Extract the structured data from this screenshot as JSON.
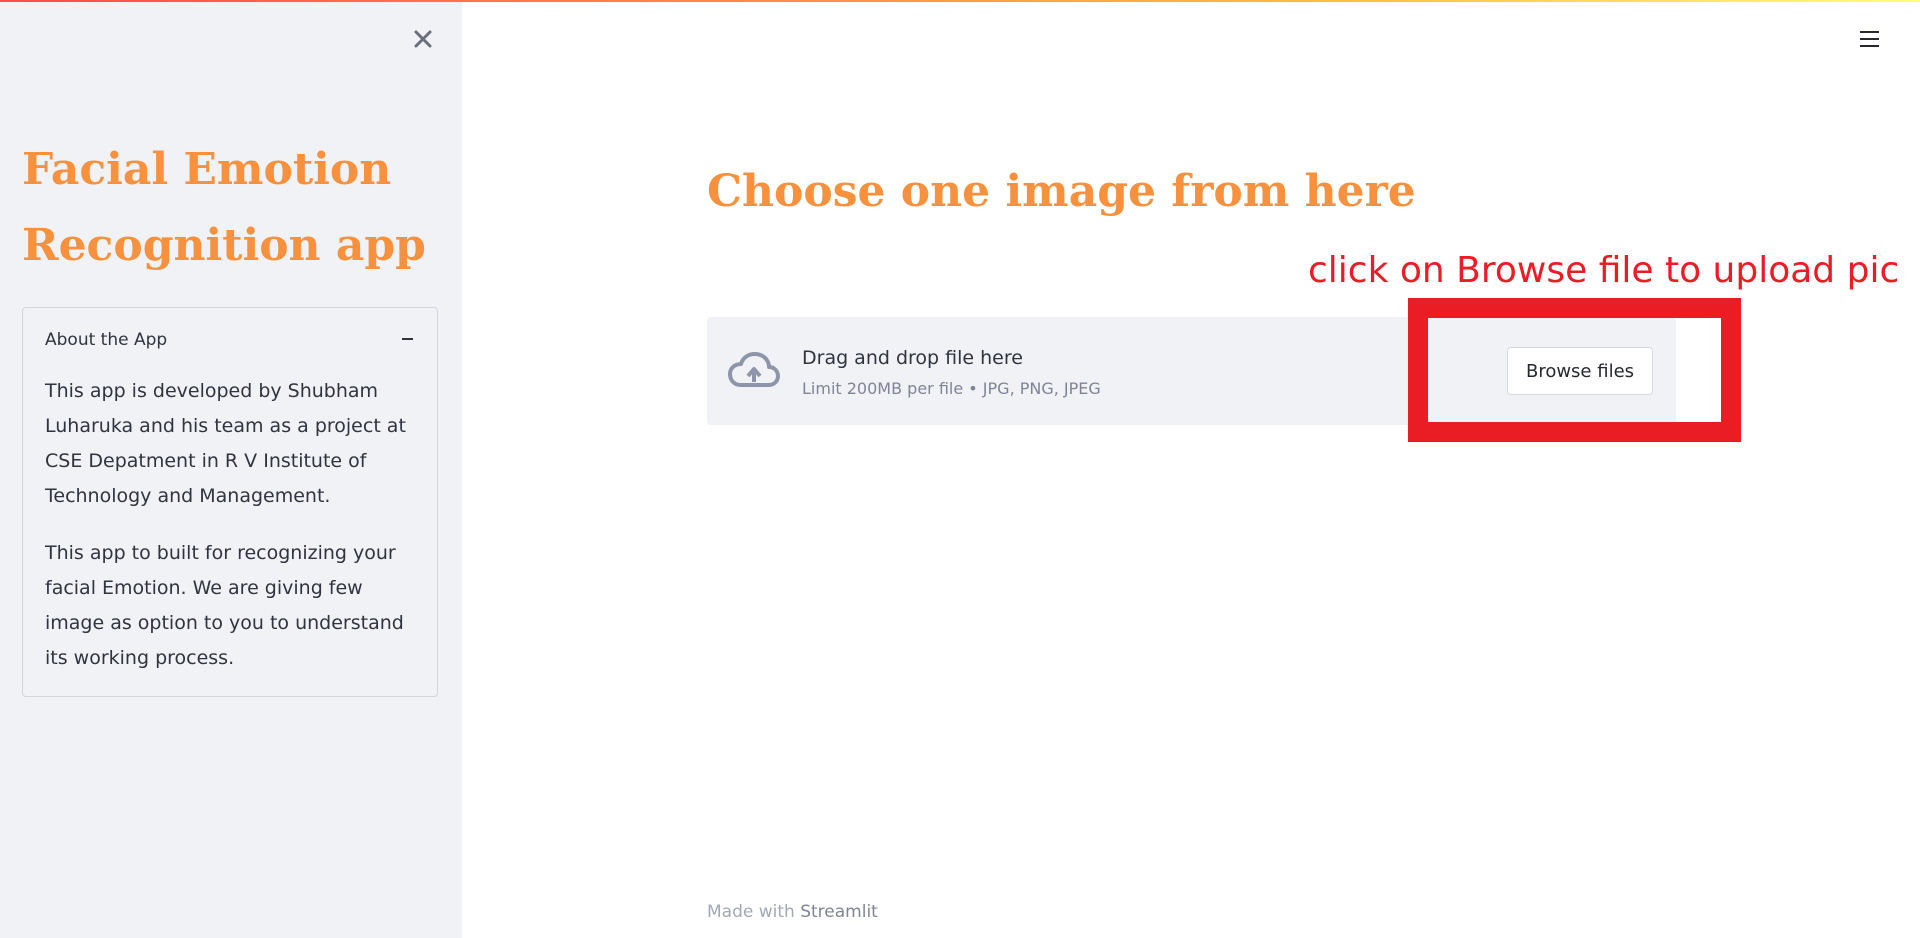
{
  "sidebar": {
    "close_icon": "×",
    "title": "Facial Emotion Recognition app",
    "expander": {
      "label": "About the App",
      "paragraphs": [
        "This app is developed by Shubham Luharuka and his team as a project at CSE Depatment in R V Institute of Technology and Management.",
        "This app to built for recognizing your facial Emotion. We are giving few image as option to you to understand its working process."
      ]
    }
  },
  "header": {
    "menu_icon": "hamburger-menu-icon"
  },
  "main": {
    "title": "Choose one image from here",
    "uploader": {
      "drop_label": "Drag and drop file here",
      "limit_label": "Limit 200MB per file • JPG, PNG, JPEG",
      "browse_label": "Browse files",
      "icon": "cloud-upload-icon"
    },
    "annotation": "click on Browse file to upload pic"
  },
  "footer": {
    "prefix": "Made with",
    "link": "Streamlit"
  },
  "colors": {
    "accent_orange": "#f7913d",
    "annotation_red": "#ea1c24",
    "sidebar_bg": "#f0f2f6",
    "text": "#31333f"
  }
}
